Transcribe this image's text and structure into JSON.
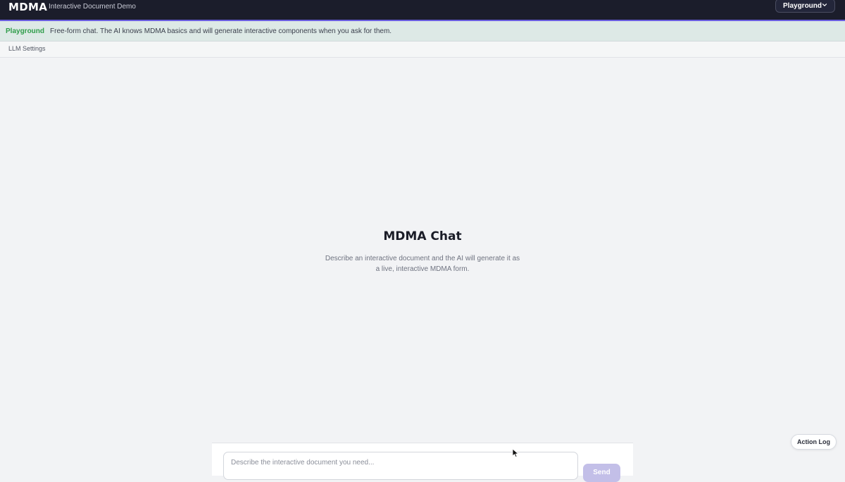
{
  "header": {
    "brand": "MDMA",
    "subtitle": "Interactive Document Demo",
    "mode_selector": {
      "selected": "Playground",
      "icon": "chevron-down-icon"
    }
  },
  "banner": {
    "tag": "Playground",
    "description": "Free-form chat. The AI knows MDMA basics and will generate interactive components when you ask for them."
  },
  "settings": {
    "label": "LLM Settings"
  },
  "empty_state": {
    "title": "MDMA Chat",
    "description": "Describe an interactive document and the AI will generate it as a live, interactive MDMA form."
  },
  "composer": {
    "placeholder": "Describe the interactive document you need...",
    "value": "",
    "send_label": "Send"
  },
  "action_log": {
    "label": "Action Log"
  },
  "colors": {
    "topbar_bg": "#1b1d2b",
    "accent": "#6b5fe0",
    "banner_bg": "#dde9e6",
    "banner_tag": "#2f9d4a",
    "send_disabled": "#c3bfe8"
  }
}
